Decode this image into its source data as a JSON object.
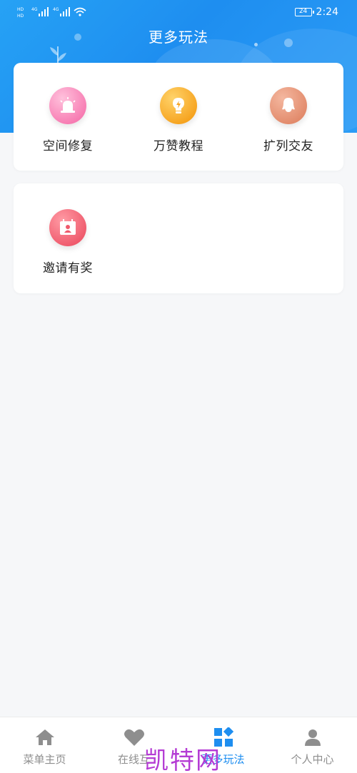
{
  "status_bar": {
    "network_labels": [
      "4G",
      "4G"
    ],
    "battery": "24",
    "time": "2:24"
  },
  "header": {
    "title": "更多玩法"
  },
  "cards": [
    {
      "items": [
        {
          "label": "空间修复",
          "icon": "siren-icon",
          "color": "#f77bb2"
        },
        {
          "label": "万赞教程",
          "icon": "lightbulb-icon",
          "color": "#f6a31f"
        },
        {
          "label": "扩列交友",
          "icon": "penguin-icon",
          "color": "#e28a6b"
        }
      ]
    },
    {
      "items": [
        {
          "label": "邀请有奖",
          "icon": "calendar-user-icon",
          "color": "#ef5a6c"
        }
      ]
    }
  ],
  "tab_bar": {
    "items": [
      {
        "label": "菜单主页",
        "icon": "home-icon",
        "active": false
      },
      {
        "label": "在线互",
        "icon": "heart-icon",
        "active": false
      },
      {
        "label": "更多玩法",
        "icon": "grid-icon",
        "active": true
      },
      {
        "label": "个人中心",
        "icon": "user-icon",
        "active": false
      }
    ]
  },
  "watermark": "凯特网",
  "colors": {
    "accent": "#1e8ef0",
    "inactive_tab": "#8e8e8e"
  }
}
